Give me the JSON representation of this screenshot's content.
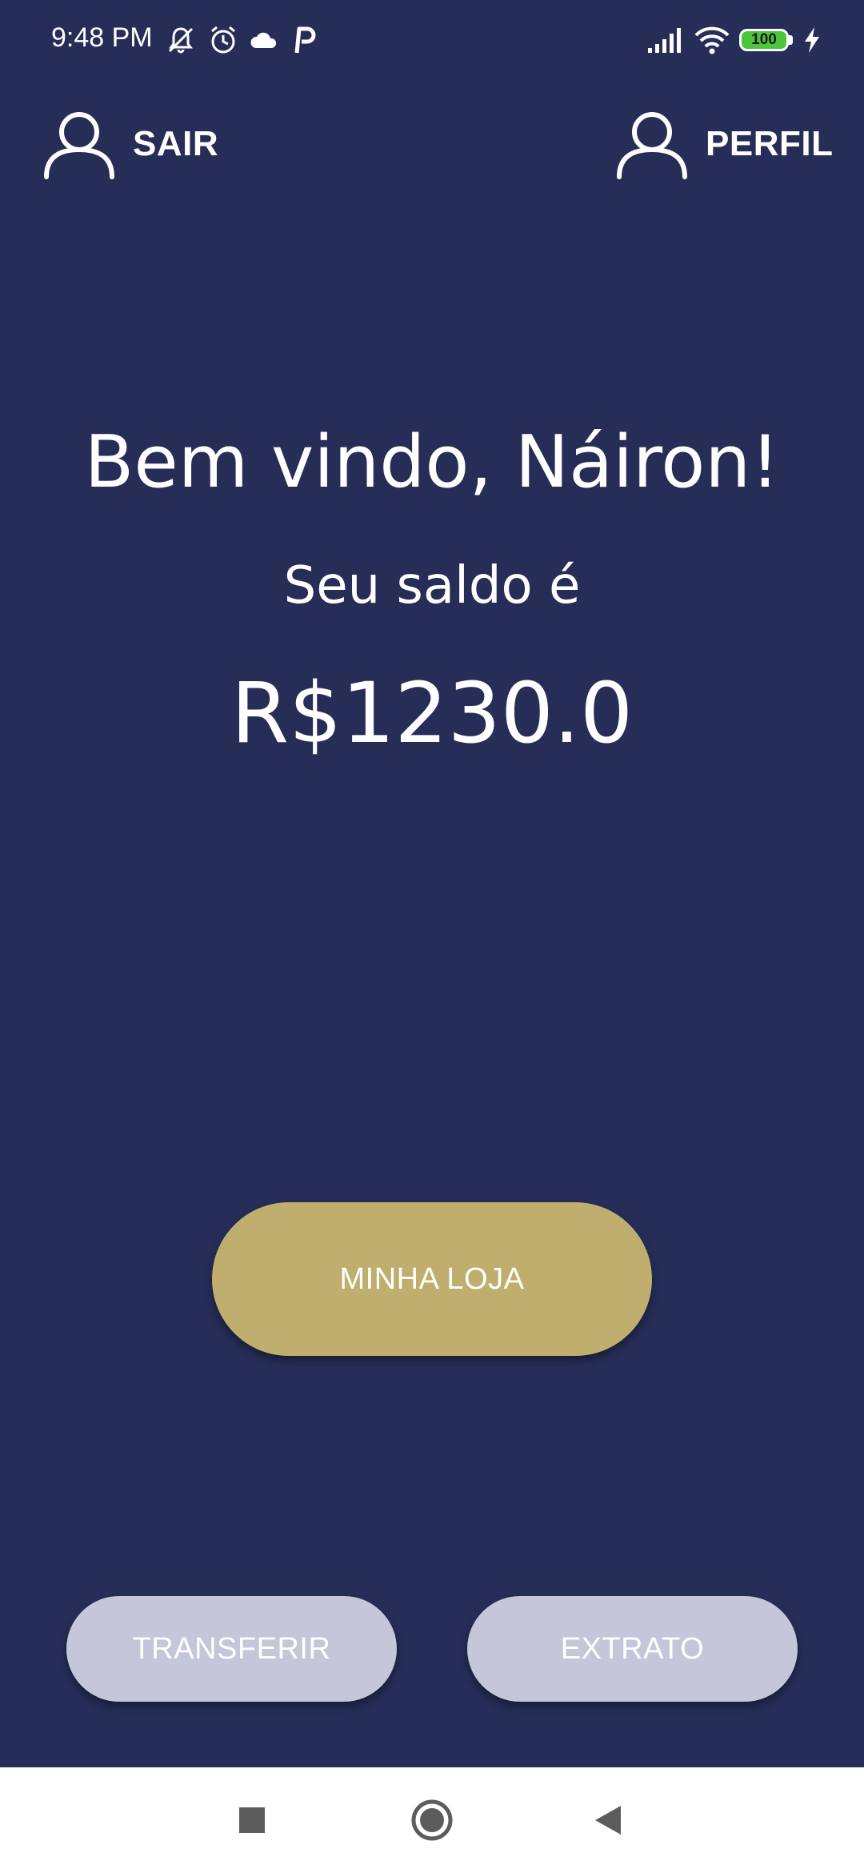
{
  "status_bar": {
    "time": "9:48 PM",
    "battery_level": "100",
    "icons": [
      "mute-bell-icon",
      "alarm-icon",
      "cloud-icon",
      "p-icon",
      "signal-icon",
      "wifi-icon",
      "battery-icon",
      "charging-icon"
    ]
  },
  "header": {
    "logout_label": "SAIR",
    "profile_label": "PERFIL"
  },
  "main": {
    "welcome": "Bem vindo, Náiron!",
    "balance_label": "Seu saldo é",
    "balance_value": "R$1230.0"
  },
  "actions": {
    "store_label": "MINHA LOJA",
    "transfer_label": "TRANSFERIR",
    "extract_label": "EXTRATO"
  },
  "colors": {
    "background": "#262d57",
    "store_button": "#bfae6d",
    "secondary_button": "#c4c7da",
    "battery": "#4cc53c"
  }
}
